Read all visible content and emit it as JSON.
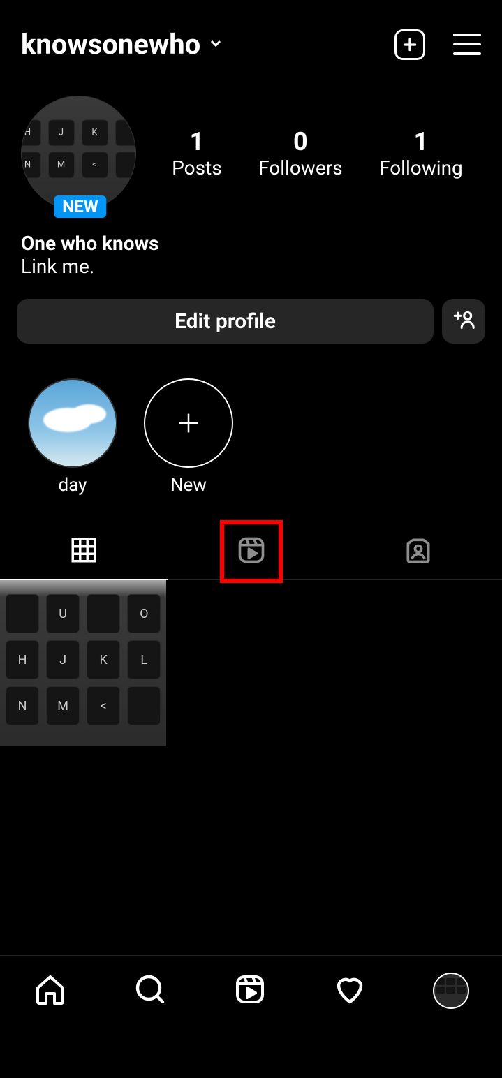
{
  "header": {
    "username": "knowsonewho"
  },
  "profile": {
    "new_badge": "NEW",
    "display_name": "One who knows",
    "bio_text": "Link me."
  },
  "stats": {
    "posts_count": "1",
    "posts_label": "Posts",
    "followers_count": "0",
    "followers_label": "Followers",
    "following_count": "1",
    "following_label": "Following"
  },
  "actions": {
    "edit_label": "Edit profile"
  },
  "highlights": [
    {
      "label": "day"
    },
    {
      "label": "New"
    }
  ]
}
